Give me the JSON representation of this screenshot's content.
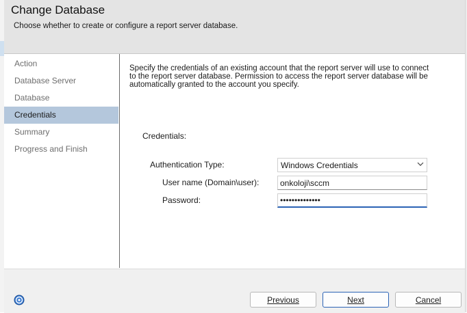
{
  "header": {
    "title": "Change Database",
    "subtitle": "Choose whether to create or configure a report server database."
  },
  "nav": {
    "items": [
      "Action",
      "Database Server",
      "Database",
      "Credentials",
      "Summary",
      "Progress and Finish"
    ],
    "active": "Credentials"
  },
  "content": {
    "intro": "Specify the credentials of an existing account that the report server will use to connect to the report server database.  Permission to access the report server database will be automatically granted to the account you specify.",
    "credentials_label": "Credentials:",
    "auth_type_label": "Authentication Type:",
    "auth_type_value": "Windows Credentials",
    "username_label": "User name (Domain\\user):",
    "username_value": "onkoloji\\sccm",
    "password_label": "Password:",
    "password_value": "••••••••••••••"
  },
  "footer": {
    "previous": "Previous",
    "next": "Next",
    "cancel": "Cancel"
  }
}
